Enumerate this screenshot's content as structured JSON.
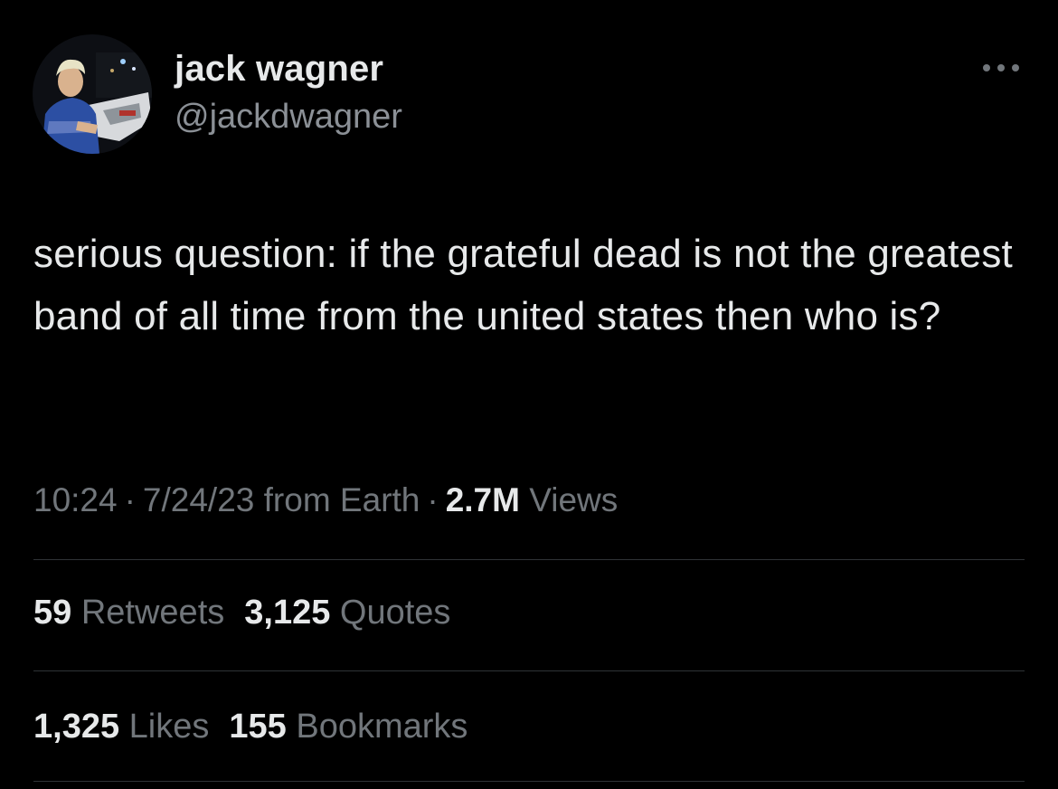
{
  "colors": {
    "background": "#000000",
    "primary_text": "#e7e9ea",
    "secondary_text": "#71767b",
    "divider": "#2f3336"
  },
  "author": {
    "display_name": "jack wagner",
    "handle": "@jackdwagner",
    "avatar_icon": "profile-photo"
  },
  "more_icon": "ellipsis-icon",
  "tweet": {
    "text": "serious question: if the grateful dead is not the greatest band of all time from the united states then who is?"
  },
  "meta": {
    "time": "10:24",
    "separator": "·",
    "date": "7/24/23",
    "source": "from Earth",
    "views_count": "2.7M",
    "views_label": "Views"
  },
  "stats": {
    "retweets_count": "59",
    "retweets_label": "Retweets",
    "quotes_count": "3,125",
    "quotes_label": "Quotes",
    "likes_count": "1,325",
    "likes_label": "Likes",
    "bookmarks_count": "155",
    "bookmarks_label": "Bookmarks"
  }
}
